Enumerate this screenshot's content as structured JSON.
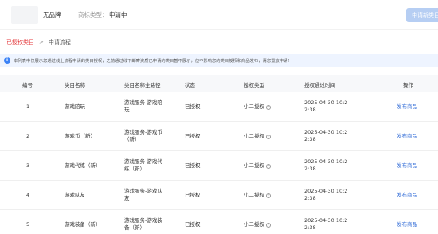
{
  "header": {
    "brand": "无品牌",
    "type_label": "商标类型：",
    "type_value": "申请中",
    "apply_button": "申请新类目"
  },
  "breadcrumb": {
    "active": "已授权类目",
    "separator": ">",
    "current": "申请流程"
  },
  "notice": {
    "text": "本列表中仅展示您通过线上流程申请的类目授权，之前通过线下邮寄资质已申请的类目暂不展示，但不影响您的类目授权和商品发布，请您置放申请!"
  },
  "table": {
    "columns": [
      "编号",
      "类目名称",
      "类目名称全路径",
      "状态",
      "授权类型",
      "授权通过时间",
      "操作"
    ],
    "rows": [
      {
        "id": "1",
        "name": "游戏陪玩",
        "path_l1": "游戏服务-游戏陪",
        "path_l2": "玩",
        "status": "已授权",
        "auth_type": "小二授权",
        "time_l1": "2025-04-30 10:2",
        "time_l2": "2:38",
        "action": "发布商品"
      },
      {
        "id": "2",
        "name": "游戏币（新）",
        "path_l1": "游戏服务-游戏币",
        "path_l2": "（新）",
        "status": "已授权",
        "auth_type": "小二授权",
        "time_l1": "2025-04-30 10:2",
        "time_l2": "2:38",
        "action": "发布商品"
      },
      {
        "id": "3",
        "name": "游戏代练（新）",
        "path_l1": "游戏服务-游戏代",
        "path_l2": "练（新）",
        "status": "已授权",
        "auth_type": "小二授权",
        "time_l1": "2025-04-30 10:2",
        "time_l2": "2:38",
        "action": "发布商品"
      },
      {
        "id": "4",
        "name": "游戏队友",
        "path_l1": "游戏服务-游戏队",
        "path_l2": "友",
        "status": "已授权",
        "auth_type": "小二授权",
        "time_l1": "2025-04-30 10:2",
        "time_l2": "2:38",
        "action": "发布商品"
      },
      {
        "id": "5",
        "name": "游戏装备（新）",
        "path_l1": "游戏服务-游戏装",
        "path_l2": "备（新）",
        "status": "已授权",
        "auth_type": "小二授权",
        "time_l1": "2025-04-30 10:2",
        "time_l2": "2:38",
        "action": "发布商品"
      }
    ]
  }
}
